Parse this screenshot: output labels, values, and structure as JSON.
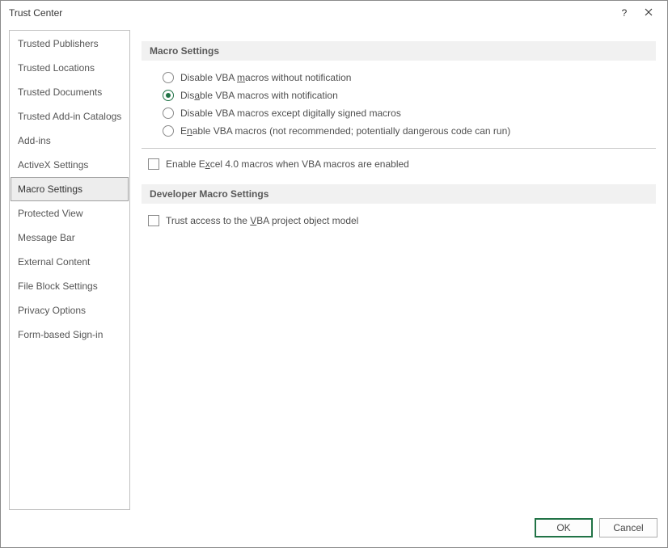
{
  "window": {
    "title": "Trust Center"
  },
  "sidebar": {
    "items": [
      {
        "label": "Trusted Publishers"
      },
      {
        "label": "Trusted Locations"
      },
      {
        "label": "Trusted Documents"
      },
      {
        "label": "Trusted Add-in Catalogs"
      },
      {
        "label": "Add-ins"
      },
      {
        "label": "ActiveX Settings"
      },
      {
        "label": "Macro Settings"
      },
      {
        "label": "Protected View"
      },
      {
        "label": "Message Bar"
      },
      {
        "label": "External Content"
      },
      {
        "label": "File Block Settings"
      },
      {
        "label": "Privacy Options"
      },
      {
        "label": "Form-based Sign-in"
      }
    ],
    "selected_index": 6
  },
  "sections": {
    "macro_settings": {
      "header": "Macro Settings",
      "options": {
        "disable_no_notif": {
          "pre": "Disable VBA ",
          "u": "m",
          "post": "acros without notification"
        },
        "disable_with_notif": {
          "pre": "Dis",
          "u": "a",
          "post": "ble VBA macros with notification"
        },
        "disable_except_signed": {
          "pre": "Disable VBA macros except di",
          "u": "g",
          "post": "itally signed macros"
        },
        "enable_all": {
          "pre": "E",
          "u": "n",
          "post": "able VBA macros (not recommended; potentially dangerous code can run)"
        }
      },
      "selected": "disable_with_notif",
      "excel4": {
        "pre": "Enable E",
        "u": "x",
        "post": "cel 4.0 macros when VBA macros are enabled"
      }
    },
    "dev_macro_settings": {
      "header": "Developer Macro Settings",
      "trust_vba": {
        "pre": "Trust access to the ",
        "u": "V",
        "post": "BA project object model"
      }
    }
  },
  "buttons": {
    "ok": "OK",
    "cancel": "Cancel"
  }
}
